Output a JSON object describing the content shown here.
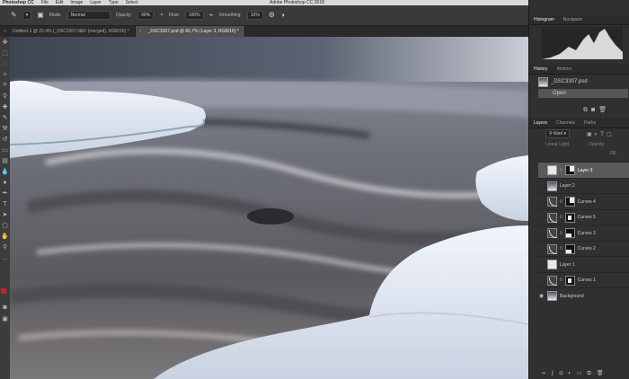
{
  "menubar": {
    "app": "Photoshop CC",
    "items": [
      "File",
      "Edit",
      "Image",
      "Layer",
      "Type",
      "Select"
    ],
    "window_title": "Adobe Photoshop CC 2018"
  },
  "options": {
    "mode_label": "Mode:",
    "mode_value": "Normal",
    "opacity_label": "Opacity:",
    "opacity_value": "90%",
    "flow_label": "Flow:",
    "flow_value": "100%",
    "smoothing_label": "Smoothing:",
    "smoothing_value": "10%"
  },
  "tabs": [
    {
      "label": "Untitled-1 @ 22,4% (_DSC3307.NEF (merged), RGB/16) *",
      "active": false
    },
    {
      "label": "_DSC3307.psd @ 66,7% (Layer 3, RGB/16) *",
      "active": true
    }
  ],
  "panels": {
    "histogram_tabs": [
      "Histogram",
      "Navigator"
    ],
    "history_tabs": [
      "History",
      "Actions"
    ],
    "history_items": [
      "_DSC3307.psd",
      "Open"
    ],
    "layers_tabs": [
      "Layers",
      "Channels",
      "Paths"
    ],
    "kind_label": "Kind",
    "blend_mode": "Linear Light",
    "opacity_label": "Opacity:",
    "fill_label": "Fill:",
    "layers": [
      {
        "name": "Layer 3",
        "thumb": "white",
        "mask": "a",
        "selected": true,
        "visible": false
      },
      {
        "name": "Layer 2",
        "thumb": "photo",
        "mask": "",
        "selected": false,
        "visible": false
      },
      {
        "name": "Curves 4",
        "thumb": "curve",
        "mask": "a",
        "selected": false,
        "visible": false
      },
      {
        "name": "Curves 5",
        "thumb": "curve",
        "mask": "c",
        "selected": false,
        "visible": false
      },
      {
        "name": "Curves 3",
        "thumb": "curve",
        "mask": "b",
        "selected": false,
        "visible": false
      },
      {
        "name": "Curves 2",
        "thumb": "curve",
        "mask": "b",
        "selected": false,
        "visible": false
      },
      {
        "name": "Layer 1",
        "thumb": "white",
        "mask": "",
        "selected": false,
        "visible": false
      },
      {
        "name": "Curves 1",
        "thumb": "curve",
        "mask": "c",
        "selected": false,
        "visible": false
      },
      {
        "name": "Background",
        "thumb": "photo",
        "mask": "",
        "selected": false,
        "visible": true
      }
    ]
  },
  "colors": {
    "foreground": "#cc1f1f",
    "background": "#ffffff",
    "accent": "#3d6bb3"
  }
}
